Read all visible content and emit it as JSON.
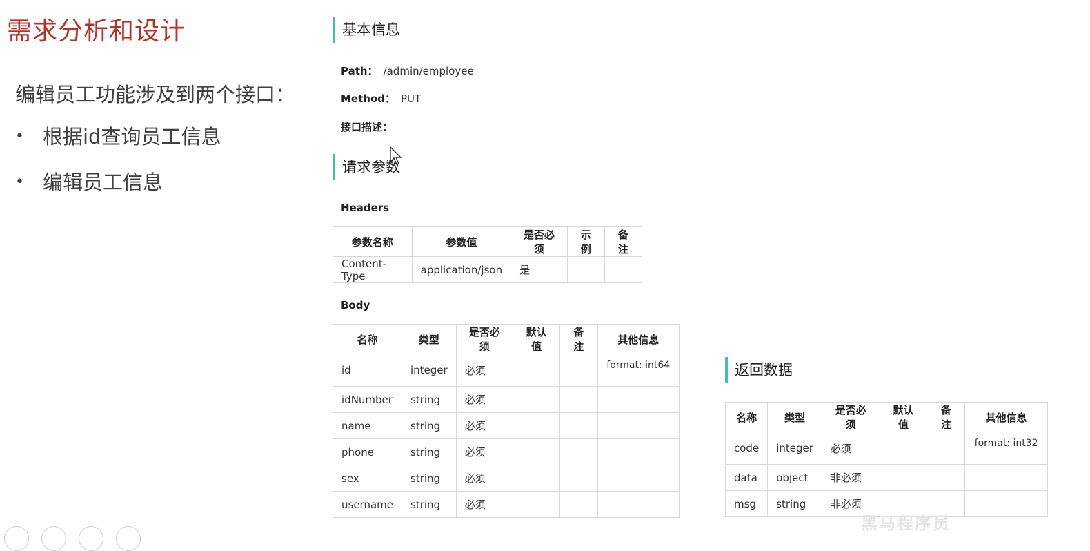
{
  "slide": {
    "title": "需求分析和设计",
    "intro": "编辑员工功能涉及到两个接口：",
    "bullets": [
      "根据id查询员工信息",
      "编辑员工信息"
    ]
  },
  "basic_info": {
    "heading": "基本信息",
    "path_label": "Path：",
    "path_value": "/admin/employee",
    "method_label": "Method：",
    "method_value": "PUT",
    "desc_label": "接口描述："
  },
  "request": {
    "heading": "请求参数",
    "headers_label": "Headers",
    "headers_columns": [
      "参数名称",
      "参数值",
      "是否必须",
      "示例",
      "备注"
    ],
    "headers_rows": [
      [
        "Content-Type",
        "application/json",
        "是",
        "",
        ""
      ]
    ],
    "body_label": "Body",
    "body_columns": [
      "名称",
      "类型",
      "是否必须",
      "默认值",
      "备注",
      "其他信息"
    ],
    "body_rows": [
      [
        "id",
        "integer",
        "必须",
        "",
        "",
        "format: int64"
      ],
      [
        "idNumber",
        "string",
        "必须",
        "",
        "",
        ""
      ],
      [
        "name",
        "string",
        "必须",
        "",
        "",
        ""
      ],
      [
        "phone",
        "string",
        "必须",
        "",
        "",
        ""
      ],
      [
        "sex",
        "string",
        "必须",
        "",
        "",
        ""
      ],
      [
        "username",
        "string",
        "必须",
        "",
        "",
        ""
      ]
    ]
  },
  "response": {
    "heading": "返回数据",
    "columns": [
      "名称",
      "类型",
      "是否必须",
      "默认值",
      "备注",
      "其他信息"
    ],
    "rows": [
      [
        "code",
        "integer",
        "必须",
        "",
        "",
        "format: int32"
      ],
      [
        "data",
        "object",
        "非必须",
        "",
        "",
        ""
      ],
      [
        "msg",
        "string",
        "非必须",
        "",
        "",
        ""
      ]
    ]
  },
  "watermark": "黑马程序员",
  "colors": {
    "title": "#b5322a",
    "accent": "#42c29e"
  }
}
